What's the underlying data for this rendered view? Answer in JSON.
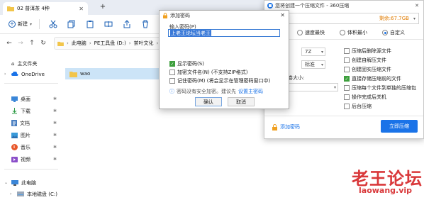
{
  "explorer": {
    "tab_title": "02 普洱茶 4种",
    "new_label": "新建",
    "breadcrumb": [
      "此电脑",
      "PE工具盘 (D:)",
      "茶叶文化"
    ],
    "file_name": "wao",
    "sidebar": {
      "home": "主文件夹",
      "onedrive": "OneDrive",
      "quick": [
        "桌面",
        "下载",
        "文档",
        "图片",
        "音乐",
        "视频"
      ],
      "this_pc": "此电脑",
      "local_disk": "本地磁盘 (C:)"
    }
  },
  "zip_dialog": {
    "title": "您将创建一个压缩文件 - 360压缩",
    "free_space": "剩余:67.7GB",
    "radios": [
      "速度最快",
      "体积最小",
      "自定义"
    ],
    "radio_selected": 2,
    "row_labels": [
      "式:",
      "式:",
      "分卷大小:"
    ],
    "select_values": [
      "7Z",
      "标准",
      ""
    ],
    "options": [
      {
        "label": "压缩后删除源文件",
        "checked": false
      },
      {
        "label": "创建自解压文件",
        "checked": false
      },
      {
        "label": "创建固实压缩文件",
        "checked": false
      },
      {
        "label": "直接存储压缩前的文件",
        "checked": true
      },
      {
        "label": "压缩每个文件到单独的压缩包",
        "checked": false
      },
      {
        "label": "操作完成后关机",
        "checked": false
      },
      {
        "label": "后台压缩",
        "checked": false
      }
    ],
    "add_password": "添加密码",
    "start_button": "立即压缩"
  },
  "password_dialog": {
    "title": "添加密码",
    "input_label": "输入密码(P)",
    "password_value": "上老王论坛当老王",
    "show_password": "显示密码(S)",
    "show_password_checked": true,
    "encrypt_names": "加密文件名(N) (不支持ZIP格式)",
    "remember_password": "记住密码(M) (将会显示在管理密码窗口中)",
    "note": "密码没有安全加密。建议先",
    "note_link": "设置主密码",
    "ok": "确认",
    "cancel": "取消"
  },
  "watermark": {
    "cn": "老王论坛",
    "url": "laowang.vip"
  },
  "colors": {
    "accent": "#1a73e8",
    "check_green": "#3d9f3d",
    "free_space": "#e07b00",
    "watermark": "#d9383a",
    "selection": "#cce4f7"
  }
}
